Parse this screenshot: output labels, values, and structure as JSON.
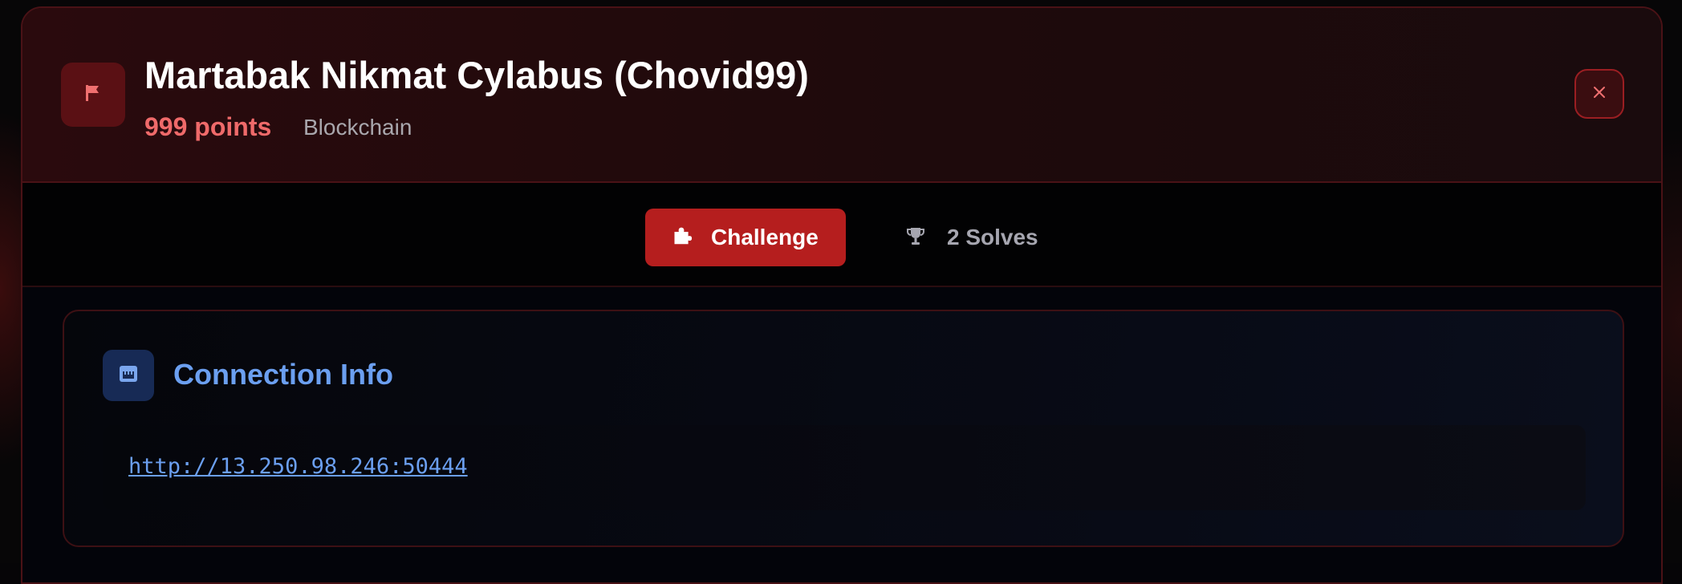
{
  "challenge": {
    "title": "Martabak Nikmat Cylabus (Chovid99)",
    "points": "999 points",
    "category": "Blockchain"
  },
  "tabs": [
    {
      "label": "Challenge",
      "icon": "puzzle-icon",
      "active": true
    },
    {
      "label": "2 Solves",
      "icon": "trophy-icon",
      "active": false
    }
  ],
  "connection": {
    "title": "Connection Info",
    "url": "http://13.250.98.246:50444"
  },
  "icons": {
    "header": "flag-icon",
    "close": "close-icon",
    "connection": "ethernet-icon"
  },
  "colors": {
    "accent_red": "#b51e1e",
    "points_red": "#ef6a6a",
    "link_blue": "#6b9ff0",
    "border_red": "#4a1216"
  }
}
